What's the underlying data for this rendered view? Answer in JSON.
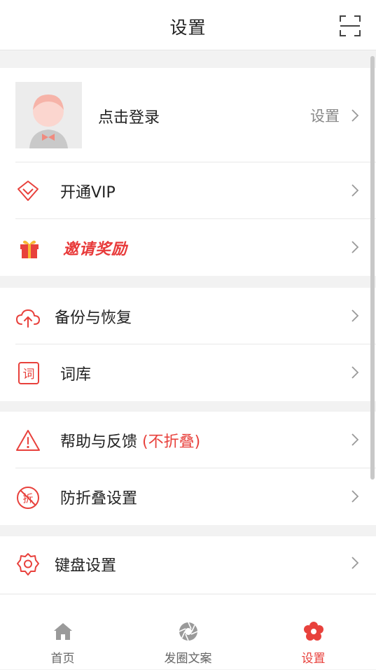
{
  "header": {
    "title": "设置",
    "scan_icon": "scan-icon"
  },
  "profile": {
    "login_text": "点击登录",
    "settings_text": "设置"
  },
  "menu": {
    "vip": "开通VIP",
    "invite": "邀请奖励",
    "backup": "备份与恢复",
    "lexicon": "词库",
    "lexicon_icon_char": "词",
    "help": "帮助与反馈",
    "help_badge": "(不折叠)",
    "antifold": "防折叠设置",
    "antifold_icon_char": "拆",
    "keyboard": "键盘设置"
  },
  "tabbar": {
    "tabs": [
      {
        "label": "首页",
        "icon": "home-icon",
        "active": false
      },
      {
        "label": "发圈文案",
        "icon": "aperture-icon",
        "active": false
      },
      {
        "label": "设置",
        "icon": "flower-settings-icon",
        "active": true
      }
    ]
  },
  "colors": {
    "accent": "#e8413c",
    "background": "#f2f2f2",
    "text": "#222222",
    "muted": "#888888"
  }
}
